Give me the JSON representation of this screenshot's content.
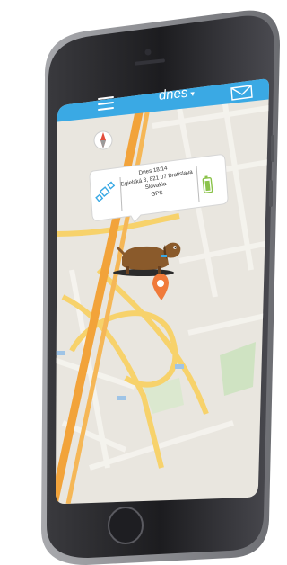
{
  "app": {
    "title": "dnes",
    "title_caret": "▾"
  },
  "toolbar": {
    "menu_icon": "hamburger-menu-icon",
    "mail_icon": "envelope-icon",
    "color": "#3aa9e4"
  },
  "map": {
    "compass_icon": "compass-icon",
    "marker_icon": "location-pin-icon",
    "marker_color": "#f07a3a",
    "pet_icon": "dog-icon"
  },
  "info_card": {
    "date_time": "Dnes 18:14",
    "address_line1": "Egielská 8, 821 07 Bratislava",
    "country": "Slovakia",
    "source": "GPS",
    "satellite_icon": "satellite-icon",
    "battery_icon": "battery-icon",
    "battery_color": "#8bc34a"
  }
}
